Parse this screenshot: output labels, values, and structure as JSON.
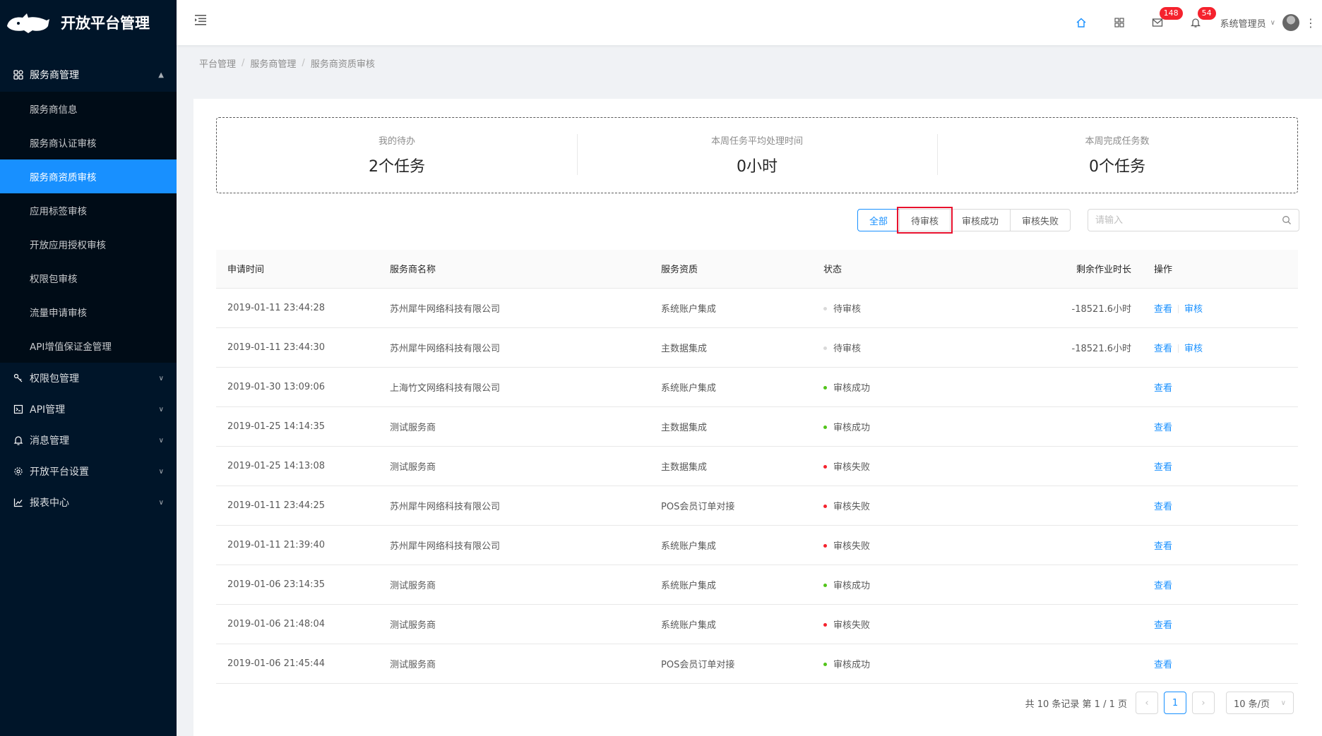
{
  "app": {
    "title": "开放平台管理"
  },
  "sidebar": {
    "group_open": {
      "label": "服务商管理",
      "icon": "partners-icon"
    },
    "sub_items": [
      {
        "label": "服务商信息",
        "active": false
      },
      {
        "label": "服务商认证审核",
        "active": false
      },
      {
        "label": "服务商资质审核",
        "active": true
      },
      {
        "label": "应用标签审核",
        "active": false
      },
      {
        "label": "开放应用授权审核",
        "active": false
      },
      {
        "label": "权限包审核",
        "active": false
      },
      {
        "label": "流量申请审核",
        "active": false
      },
      {
        "label": "API增值保证金管理",
        "active": false
      }
    ],
    "groups_closed": [
      {
        "label": "权限包管理",
        "icon": "key-icon"
      },
      {
        "label": "API管理",
        "icon": "api-icon"
      },
      {
        "label": "消息管理",
        "icon": "bell-icon"
      },
      {
        "label": "开放平台设置",
        "icon": "gear-icon"
      },
      {
        "label": "报表中心",
        "icon": "chart-icon"
      }
    ]
  },
  "header": {
    "mail_badge": "148",
    "bell_badge": "54",
    "user_name": "系统管理员"
  },
  "breadcrumb": [
    "平台管理",
    "服务商管理",
    "服务商资质审核"
  ],
  "stats": [
    {
      "label": "我的待办",
      "value": "2个任务"
    },
    {
      "label": "本周任务平均处理时间",
      "value": "0小时"
    },
    {
      "label": "本周完成任务数",
      "value": "0个任务"
    }
  ],
  "filters": {
    "all": "全部",
    "pending": "待审核",
    "success": "审核成功",
    "failed": "审核失败",
    "selected": "全部",
    "outlined": "待审核"
  },
  "search": {
    "placeholder": "请输入",
    "value": ""
  },
  "table": {
    "columns": [
      "申请时间",
      "服务商名称",
      "服务资质",
      "状态",
      "剩余作业时长",
      "操作"
    ],
    "rows": [
      {
        "time": "2019-01-11 23:44:28",
        "name": "苏州犀牛网络科技有限公司",
        "qual": "系统账户集成",
        "status": "待审核",
        "status_color": "#d9d9d9",
        "remain": "-18521.6小时",
        "ops": [
          "查看",
          "审核"
        ]
      },
      {
        "time": "2019-01-11 23:44:30",
        "name": "苏州犀牛网络科技有限公司",
        "qual": "主数据集成",
        "status": "待审核",
        "status_color": "#d9d9d9",
        "remain": "-18521.6小时",
        "ops": [
          "查看",
          "审核"
        ]
      },
      {
        "time": "2019-01-30 13:09:06",
        "name": "上海竹文网络科技有限公司",
        "qual": "系统账户集成",
        "status": "审核成功",
        "status_color": "#52c41a",
        "remain": "",
        "ops": [
          "查看"
        ]
      },
      {
        "time": "2019-01-25 14:14:35",
        "name": "测试服务商",
        "qual": "主数据集成",
        "status": "审核成功",
        "status_color": "#52c41a",
        "remain": "",
        "ops": [
          "查看"
        ]
      },
      {
        "time": "2019-01-25 14:13:08",
        "name": "测试服务商",
        "qual": "主数据集成",
        "status": "审核失败",
        "status_color": "#f5222d",
        "remain": "",
        "ops": [
          "查看"
        ]
      },
      {
        "time": "2019-01-11 23:44:25",
        "name": "苏州犀牛网络科技有限公司",
        "qual": "POS会员订单对接",
        "status": "审核失败",
        "status_color": "#f5222d",
        "remain": "",
        "ops": [
          "查看"
        ]
      },
      {
        "time": "2019-01-11 21:39:40",
        "name": "苏州犀牛网络科技有限公司",
        "qual": "系统账户集成",
        "status": "审核失败",
        "status_color": "#f5222d",
        "remain": "",
        "ops": [
          "查看"
        ]
      },
      {
        "time": "2019-01-06 23:14:35",
        "name": "测试服务商",
        "qual": "系统账户集成",
        "status": "审核成功",
        "status_color": "#52c41a",
        "remain": "",
        "ops": [
          "查看"
        ]
      },
      {
        "time": "2019-01-06 21:48:04",
        "name": "测试服务商",
        "qual": "系统账户集成",
        "status": "审核失败",
        "status_color": "#f5222d",
        "remain": "",
        "ops": [
          "查看"
        ]
      },
      {
        "time": "2019-01-06 21:45:44",
        "name": "测试服务商",
        "qual": "POS会员订单对接",
        "status": "审核成功",
        "status_color": "#52c41a",
        "remain": "",
        "ops": [
          "查看"
        ]
      }
    ]
  },
  "pagination": {
    "summary": "共 10 条记录 第 1 / 1 页",
    "current": "1",
    "page_size": "10 条/页"
  },
  "colors": {
    "primary": "#1890ff",
    "sidebar_bg": "#001529",
    "highlight_outline": "#e8112d"
  }
}
